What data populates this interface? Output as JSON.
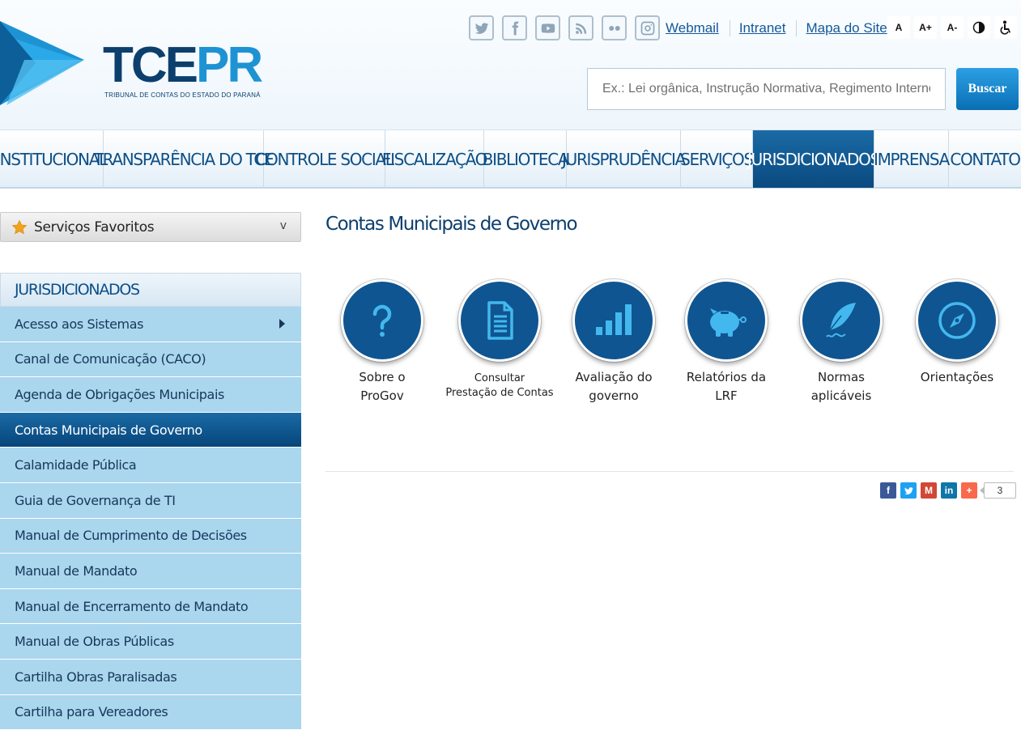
{
  "header": {
    "logo_main": "TCE",
    "logo_accent": "PR",
    "logo_subtitle": "TRIBUNAL DE CONTAS DO ESTADO DO PARANÁ",
    "social": [
      "twitter-icon",
      "facebook-icon",
      "youtube-icon",
      "rss-icon",
      "flickr-icon",
      "instagram-icon"
    ],
    "links": [
      "Webmail",
      "Intranet",
      "Mapa do Site"
    ],
    "a11y": [
      "A",
      "A+",
      "A-",
      "contrast-icon",
      "accessibility-icon"
    ],
    "search_placeholder": "Ex.: Lei orgânica, Instrução Normativa, Regimento Interno",
    "search_button": "Buscar"
  },
  "nav": {
    "items": [
      "INSTITUCIONAL",
      "TRANSPARÊNCIA DO TCE",
      "CONTROLE SOCIAL",
      "FISCALIZAÇÃO",
      "BIBLIOTECA",
      "JURISPRUDÊNCIA",
      "SERVIÇOS",
      "JURISDICIONADOS",
      "IMPRENSA",
      "CONTATO"
    ],
    "active": "JURISDICIONADOS"
  },
  "sidebar": {
    "favorites_label": "Serviços Favoritos",
    "favorites_chevron": "v",
    "section_title": "JURISDICIONADOS",
    "items": [
      "Acesso aos Sistemas",
      "Canal de Comunicação (CACO)",
      "Agenda de Obrigações Municipais",
      "Contas Municipais de Governo",
      "Calamidade Pública",
      "Guia de Governança de TI",
      "Manual de Cumprimento de Decisões",
      "Manual de Mandato",
      "Manual de Encerramento de Mandato",
      "Manual de Obras Públicas",
      "Cartilha Obras Paralisadas",
      "Cartilha para Vereadores"
    ],
    "active": "Contas Municipais de Governo"
  },
  "main": {
    "title": "Contas Municipais de Governo",
    "tiles": [
      {
        "label": "Sobre o\nProGov",
        "icon": "question-icon"
      },
      {
        "label": "Consultar\nPrestação de Contas",
        "icon": "document-icon"
      },
      {
        "label": "Avaliação do\ngoverno",
        "icon": "bar-chart-icon"
      },
      {
        "label": "Relatórios da\nLRF",
        "icon": "piggy-bank-icon"
      },
      {
        "label": "Normas\naplicáveis",
        "icon": "quill-icon"
      },
      {
        "label": "Orientações",
        "icon": "compass-icon"
      }
    ],
    "share": {
      "buttons": [
        "facebook-icon",
        "twitter-icon",
        "gmail-icon",
        "linkedin-icon",
        "plus-icon"
      ],
      "count": "3"
    }
  },
  "colors": {
    "brand_dark": "#0d3f6d",
    "brand_light": "#1e93d3",
    "sidebar_item": "#aad6ee",
    "active": "#0a4a80"
  }
}
